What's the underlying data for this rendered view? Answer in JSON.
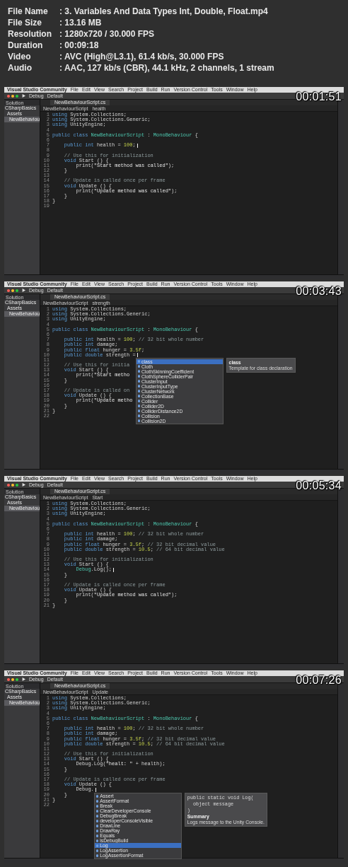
{
  "info": [
    {
      "label": "File Name",
      "value": ": 3. Variables And Data Types Int, Double, Float.mp4"
    },
    {
      "label": "File Size",
      "value": ": 13.16 MB"
    },
    {
      "label": "Resolution",
      "value": ": 1280x720 / 30.000 FPS"
    },
    {
      "label": "Duration",
      "value": ": 00:09:18"
    },
    {
      "label": "Video",
      "value": ": AVC (High@L3.1), 61.4 kb/s, 30.000 FPS"
    },
    {
      "label": "Audio",
      "value": ": AAC, 127 kb/s (CBR), 44.1 kHz, 2 channels, 1 stream"
    }
  ],
  "frames": [
    {
      "timestamp": "00:01:51",
      "app": "Visual Studio Community",
      "menu": [
        "File",
        "Edit",
        "View",
        "Search",
        "Project",
        "Build",
        "Run",
        "Version Control",
        "Tools",
        "Window",
        "Help"
      ],
      "config": [
        "Debug",
        "Default"
      ],
      "solution_label": "Solution",
      "tree": [
        {
          "label": "CSharpBasics",
          "selected": false,
          "children": [
            {
              "label": "Assets",
              "selected": false,
              "children": [
                {
                  "label": "NewBehaviou",
                  "selected": true
                }
              ]
            }
          ]
        }
      ],
      "tab": "NewBehaviourScript.cs",
      "breadcrumb": [
        "NewBehaviourScript",
        "health"
      ],
      "code": [
        {
          "n": "1",
          "parts": [
            {
              "kind": "keyword",
              "text": "using "
            },
            {
              "kind": "plain",
              "text": "System.Collections;"
            }
          ]
        },
        {
          "n": "2",
          "parts": [
            {
              "kind": "keyword",
              "text": "using "
            },
            {
              "kind": "plain",
              "text": "System.Collections.Generic;"
            }
          ]
        },
        {
          "n": "3",
          "parts": [
            {
              "kind": "keyword",
              "text": "using "
            },
            {
              "kind": "plain",
              "text": "UnityEngine;"
            }
          ]
        },
        {
          "n": "4"
        },
        {
          "n": "5",
          "parts": [
            {
              "kind": "keyword",
              "text": "public class "
            },
            {
              "kind": "type",
              "text": "NewBehaviourScript"
            },
            {
              "kind": "plain",
              "text": " : "
            },
            {
              "kind": "type",
              "text": "MonoBehaviour"
            },
            {
              "kind": "plain",
              "text": " {"
            }
          ]
        },
        {
          "n": "6"
        },
        {
          "n": "7",
          "parts": [
            {
              "kind": "keyword",
              "text": "    public int "
            },
            {
              "kind": "plain",
              "text": "health = "
            },
            {
              "kind": "number",
              "text": "100"
            },
            {
              "kind": "plain",
              "text": ";"
            },
            {
              "kind": "caret"
            }
          ]
        },
        {
          "n": "8"
        },
        {
          "n": "9",
          "parts": [
            {
              "kind": "comment",
              "text": "    // Use this for initialization"
            }
          ]
        },
        {
          "n": "10",
          "parts": [
            {
              "kind": "keyword",
              "text": "    void "
            },
            {
              "kind": "plain",
              "text": "Start () {"
            }
          ]
        },
        {
          "n": "11",
          "parts": [
            {
              "kind": "plain",
              "text": "        print("
            },
            {
              "kind": "string",
              "text": "\"Start method was called\""
            },
            {
              "kind": "plain",
              "text": ");"
            }
          ]
        },
        {
          "n": "12",
          "parts": [
            {
              "kind": "plain",
              "text": "    }"
            }
          ]
        },
        {
          "n": "13"
        },
        {
          "n": "14",
          "parts": [
            {
              "kind": "comment",
              "text": "    // Update is called once per frame"
            }
          ]
        },
        {
          "n": "15",
          "parts": [
            {
              "kind": "keyword",
              "text": "    void "
            },
            {
              "kind": "plain",
              "text": "Update () {"
            }
          ]
        },
        {
          "n": "16",
          "parts": [
            {
              "kind": "plain",
              "text": "        print("
            },
            {
              "kind": "string",
              "text": "\"Update method was called\""
            },
            {
              "kind": "plain",
              "text": ");"
            }
          ]
        },
        {
          "n": "17",
          "parts": [
            {
              "kind": "plain",
              "text": "    }"
            }
          ]
        },
        {
          "n": "18",
          "parts": [
            {
              "kind": "plain",
              "text": "}"
            }
          ]
        },
        {
          "n": "19"
        }
      ]
    },
    {
      "timestamp": "00:03:43",
      "app": "Visual Studio Community",
      "menu": [
        "File",
        "Edit",
        "View",
        "Search",
        "Project",
        "Build",
        "Run",
        "Version Control",
        "Tools",
        "Window",
        "Help"
      ],
      "config": [
        "Debug",
        "Default"
      ],
      "solution_label": "Solution",
      "tree": [
        {
          "label": "CSharpBasics",
          "selected": false,
          "children": [
            {
              "label": "Assets",
              "selected": false,
              "children": [
                {
                  "label": "NewBehaviou",
                  "selected": true
                }
              ]
            }
          ]
        }
      ],
      "tab": "NewBehaviourScript.cs",
      "breadcrumb": [
        "NewBehaviourScript",
        "strength"
      ],
      "code": [
        {
          "n": "1",
          "parts": [
            {
              "kind": "keyword",
              "text": "using "
            },
            {
              "kind": "plain",
              "text": "System.Collections;"
            }
          ]
        },
        {
          "n": "2",
          "parts": [
            {
              "kind": "keyword",
              "text": "using "
            },
            {
              "kind": "plain",
              "text": "System.Collections.Generic;"
            }
          ]
        },
        {
          "n": "3",
          "parts": [
            {
              "kind": "keyword",
              "text": "using "
            },
            {
              "kind": "plain",
              "text": "UnityEngine;"
            }
          ]
        },
        {
          "n": "4"
        },
        {
          "n": "5",
          "parts": [
            {
              "kind": "keyword",
              "text": "public class "
            },
            {
              "kind": "type",
              "text": "NewBehaviourScript"
            },
            {
              "kind": "plain",
              "text": " : "
            },
            {
              "kind": "type",
              "text": "MonoBehaviour"
            },
            {
              "kind": "plain",
              "text": " {"
            }
          ]
        },
        {
          "n": "6"
        },
        {
          "n": "7",
          "parts": [
            {
              "kind": "keyword",
              "text": "    public int "
            },
            {
              "kind": "plain",
              "text": "health = "
            },
            {
              "kind": "number",
              "text": "100"
            },
            {
              "kind": "plain",
              "text": "; "
            },
            {
              "kind": "comment",
              "text": "// 32 bit whole number"
            }
          ]
        },
        {
          "n": "8",
          "parts": [
            {
              "kind": "keyword",
              "text": "    public int "
            },
            {
              "kind": "plain",
              "text": "damage;"
            }
          ]
        },
        {
          "n": "9",
          "parts": [
            {
              "kind": "keyword",
              "text": "    public float "
            },
            {
              "kind": "plain",
              "text": "hunger = "
            },
            {
              "kind": "number",
              "text": "3.5f"
            },
            {
              "kind": "plain",
              "text": ";"
            }
          ]
        },
        {
          "n": "10",
          "parts": [
            {
              "kind": "keyword",
              "text": "    public double "
            },
            {
              "kind": "plain",
              "text": "strength ="
            },
            {
              "kind": "caret"
            }
          ]
        },
        {
          "n": "11"
        },
        {
          "n": "12",
          "parts": [
            {
              "kind": "comment",
              "text": "    // Use this for initia"
            }
          ]
        },
        {
          "n": "13",
          "parts": [
            {
              "kind": "keyword",
              "text": "    void "
            },
            {
              "kind": "plain",
              "text": "Start () {"
            }
          ]
        },
        {
          "n": "14",
          "parts": [
            {
              "kind": "plain",
              "text": "        print("
            },
            {
              "kind": "string",
              "text": "\"Start metho"
            }
          ]
        },
        {
          "n": "15",
          "parts": [
            {
              "kind": "plain",
              "text": "    }"
            }
          ]
        },
        {
          "n": "16"
        },
        {
          "n": "17",
          "parts": [
            {
              "kind": "comment",
              "text": "    // Update is called on"
            }
          ]
        },
        {
          "n": "18",
          "parts": [
            {
              "kind": "keyword",
              "text": "    void "
            },
            {
              "kind": "plain",
              "text": "Update () {"
            }
          ]
        },
        {
          "n": "19",
          "parts": [
            {
              "kind": "plain",
              "text": "        print("
            },
            {
              "kind": "string",
              "text": "\"Update metho"
            }
          ]
        },
        {
          "n": "20",
          "parts": [
            {
              "kind": "plain",
              "text": "    }"
            }
          ]
        },
        {
          "n": "21",
          "parts": [
            {
              "kind": "plain",
              "text": "}"
            }
          ]
        },
        {
          "n": "22"
        }
      ],
      "completion": {
        "items": [
          {
            "label": "class",
            "selected": true
          },
          {
            "label": "Cloth",
            "selected": false
          },
          {
            "label": "ClothSkinningCoefficient",
            "selected": false
          },
          {
            "label": "ClothSphereColliderPair",
            "selected": false
          },
          {
            "label": "ClusterInput",
            "selected": false
          },
          {
            "label": "ClusterInputType",
            "selected": false
          },
          {
            "label": "ClusterNetwork",
            "selected": false
          },
          {
            "label": "CollectionBase",
            "selected": false
          },
          {
            "label": "Collider",
            "selected": false
          },
          {
            "label": "Collider2D",
            "selected": false
          },
          {
            "label": "ColliderDistance2D",
            "selected": false
          },
          {
            "label": "Collision",
            "selected": false
          },
          {
            "label": "Collision2D",
            "selected": false
          }
        ],
        "tooltip": {
          "title": "class",
          "text": "Template for class declaration"
        }
      }
    },
    {
      "timestamp": "00:05:34",
      "app": "Visual Studio Community",
      "menu": [
        "File",
        "Edit",
        "View",
        "Search",
        "Project",
        "Build",
        "Run",
        "Version Control",
        "Tools",
        "Window",
        "Help"
      ],
      "config": [
        "Debug",
        "Default"
      ],
      "solution_label": "Solution",
      "tree": [
        {
          "label": "CSharpBasics",
          "selected": false,
          "children": [
            {
              "label": "Assets",
              "selected": false,
              "children": [
                {
                  "label": "NewBehaviou",
                  "selected": true
                }
              ]
            }
          ]
        }
      ],
      "tab": "NewBehaviourScript.cs",
      "breadcrumb": [
        "NewBehaviourScript",
        "Start"
      ],
      "code": [
        {
          "n": "1",
          "parts": [
            {
              "kind": "keyword",
              "text": "using "
            },
            {
              "kind": "plain",
              "text": "System.Collections;"
            }
          ]
        },
        {
          "n": "2",
          "parts": [
            {
              "kind": "keyword",
              "text": "using "
            },
            {
              "kind": "plain",
              "text": "System.Collections.Generic;"
            }
          ]
        },
        {
          "n": "3",
          "parts": [
            {
              "kind": "keyword",
              "text": "using "
            },
            {
              "kind": "plain",
              "text": "UnityEngine;"
            }
          ]
        },
        {
          "n": "4"
        },
        {
          "n": "5",
          "parts": [
            {
              "kind": "keyword",
              "text": "public class "
            },
            {
              "kind": "type",
              "text": "NewBehaviourScript"
            },
            {
              "kind": "plain",
              "text": " : "
            },
            {
              "kind": "type",
              "text": "MonoBehaviour"
            },
            {
              "kind": "plain",
              "text": " {"
            }
          ]
        },
        {
          "n": "6"
        },
        {
          "n": "7",
          "parts": [
            {
              "kind": "keyword",
              "text": "    public int "
            },
            {
              "kind": "plain",
              "text": "health = "
            },
            {
              "kind": "number",
              "text": "100"
            },
            {
              "kind": "plain",
              "text": "; "
            },
            {
              "kind": "comment",
              "text": "// 32 bit whole number"
            }
          ]
        },
        {
          "n": "8",
          "parts": [
            {
              "kind": "keyword",
              "text": "    public int "
            },
            {
              "kind": "plain",
              "text": "damage;"
            }
          ]
        },
        {
          "n": "9",
          "parts": [
            {
              "kind": "keyword",
              "text": "    public float "
            },
            {
              "kind": "plain",
              "text": "hunger = "
            },
            {
              "kind": "number",
              "text": "3.5f"
            },
            {
              "kind": "plain",
              "text": "; "
            },
            {
              "kind": "comment",
              "text": "// 32 bit decimal value"
            }
          ]
        },
        {
          "n": "10",
          "parts": [
            {
              "kind": "keyword",
              "text": "    public double "
            },
            {
              "kind": "plain",
              "text": "strength = "
            },
            {
              "kind": "number",
              "text": "10.5"
            },
            {
              "kind": "plain",
              "text": "; "
            },
            {
              "kind": "comment",
              "text": "// 64 bit decimal value"
            }
          ]
        },
        {
          "n": "11"
        },
        {
          "n": "12",
          "parts": [
            {
              "kind": "comment",
              "text": "    // Use this for initialization"
            }
          ]
        },
        {
          "n": "13",
          "parts": [
            {
              "kind": "keyword",
              "text": "    void "
            },
            {
              "kind": "plain",
              "text": "Start () {"
            }
          ]
        },
        {
          "n": "14",
          "parts": [
            {
              "kind": "type",
              "text": "        Debug"
            },
            {
              "kind": "plain",
              "text": ".Log();"
            },
            {
              "kind": "caret"
            }
          ]
        },
        {
          "n": "15",
          "parts": [
            {
              "kind": "plain",
              "text": "    }"
            }
          ]
        },
        {
          "n": "16"
        },
        {
          "n": "17",
          "parts": [
            {
              "kind": "comment",
              "text": "    // Update is called once per frame"
            }
          ]
        },
        {
          "n": "18",
          "parts": [
            {
              "kind": "keyword",
              "text": "    void "
            },
            {
              "kind": "plain",
              "text": "Update () {"
            }
          ]
        },
        {
          "n": "19",
          "parts": [
            {
              "kind": "plain",
              "text": "        print("
            },
            {
              "kind": "string",
              "text": "\"Update method was called\""
            },
            {
              "kind": "plain",
              "text": ");"
            }
          ]
        },
        {
          "n": "20",
          "parts": [
            {
              "kind": "plain",
              "text": "    }"
            }
          ]
        },
        {
          "n": "21",
          "parts": [
            {
              "kind": "plain",
              "text": "}"
            }
          ]
        }
      ]
    },
    {
      "timestamp": "00:07:26",
      "app": "Visual Studio Community",
      "menu": [
        "File",
        "Edit",
        "View",
        "Search",
        "Project",
        "Build",
        "Run",
        "Version Control",
        "Tools",
        "Window",
        "Help"
      ],
      "config": [
        "Debug",
        "Default"
      ],
      "solution_label": "Solution",
      "tree": [
        {
          "label": "CSharpBasics",
          "selected": false,
          "children": [
            {
              "label": "Assets",
              "selected": false,
              "children": [
                {
                  "label": "NewBehaviou",
                  "selected": true
                }
              ]
            }
          ]
        }
      ],
      "tab": "NewBehaviourScript.cs",
      "breadcrumb": [
        "NewBehaviourScript",
        "Update"
      ],
      "code": [
        {
          "n": "1",
          "parts": [
            {
              "kind": "keyword",
              "text": "using "
            },
            {
              "kind": "plain",
              "text": "System.Collections;"
            }
          ]
        },
        {
          "n": "2",
          "parts": [
            {
              "kind": "keyword",
              "text": "using "
            },
            {
              "kind": "plain",
              "text": "System.Collections.Generic;"
            }
          ]
        },
        {
          "n": "3",
          "parts": [
            {
              "kind": "keyword",
              "text": "using "
            },
            {
              "kind": "plain",
              "text": "UnityEngine;"
            }
          ]
        },
        {
          "n": "4"
        },
        {
          "n": "5",
          "parts": [
            {
              "kind": "keyword",
              "text": "public class "
            },
            {
              "kind": "type",
              "text": "NewBehaviourScript"
            },
            {
              "kind": "plain",
              "text": " : "
            },
            {
              "kind": "type",
              "text": "MonoBehaviour"
            },
            {
              "kind": "plain",
              "text": " {"
            }
          ]
        },
        {
          "n": "6"
        },
        {
          "n": "7",
          "parts": [
            {
              "kind": "keyword",
              "text": "    public int "
            },
            {
              "kind": "plain",
              "text": "health = "
            },
            {
              "kind": "number",
              "text": "100"
            },
            {
              "kind": "plain",
              "text": "; "
            },
            {
              "kind": "comment",
              "text": "// 32 bit whole number"
            }
          ]
        },
        {
          "n": "8",
          "parts": [
            {
              "kind": "keyword",
              "text": "    public int "
            },
            {
              "kind": "plain",
              "text": "damage;"
            }
          ]
        },
        {
          "n": "9",
          "parts": [
            {
              "kind": "keyword",
              "text": "    public float "
            },
            {
              "kind": "plain",
              "text": "hunger = "
            },
            {
              "kind": "number",
              "text": "3.5f"
            },
            {
              "kind": "plain",
              "text": "; "
            },
            {
              "kind": "comment",
              "text": "// 32 bit decimal value"
            }
          ]
        },
        {
          "n": "10",
          "parts": [
            {
              "kind": "keyword",
              "text": "    public double "
            },
            {
              "kind": "plain",
              "text": "strength = "
            },
            {
              "kind": "number",
              "text": "10.5"
            },
            {
              "kind": "plain",
              "text": "; "
            },
            {
              "kind": "comment",
              "text": "// 64 bit decimal value"
            }
          ]
        },
        {
          "n": "11"
        },
        {
          "n": "12",
          "parts": [
            {
              "kind": "comment",
              "text": "    // Use this for initialization"
            }
          ]
        },
        {
          "n": "13",
          "parts": [
            {
              "kind": "keyword",
              "text": "    void "
            },
            {
              "kind": "plain",
              "text": "Start () {"
            }
          ]
        },
        {
          "n": "14",
          "parts": [
            {
              "kind": "plain",
              "text": "        Debug.Log("
            },
            {
              "kind": "string",
              "text": "\"healt: \""
            },
            {
              "kind": "plain",
              "text": " + health);"
            }
          ]
        },
        {
          "n": "15",
          "parts": [
            {
              "kind": "plain",
              "text": "    }"
            }
          ]
        },
        {
          "n": "16"
        },
        {
          "n": "17",
          "parts": [
            {
              "kind": "comment",
              "text": "    // Update is called once per frame"
            }
          ]
        },
        {
          "n": "18",
          "parts": [
            {
              "kind": "keyword",
              "text": "    void "
            },
            {
              "kind": "plain",
              "text": "Update () {"
            }
          ]
        },
        {
          "n": "19",
          "parts": [
            {
              "kind": "plain",
              "text": "        Debug."
            },
            {
              "kind": "caret"
            }
          ]
        },
        {
          "n": "20",
          "parts": [
            {
              "kind": "plain",
              "text": "    }"
            }
          ]
        },
        {
          "n": "21",
          "parts": [
            {
              "kind": "plain",
              "text": "}"
            }
          ]
        },
        {
          "n": "22"
        }
      ],
      "completion": {
        "items": [
          {
            "label": "Assert",
            "selected": false
          },
          {
            "label": "AssertFormat",
            "selected": false
          },
          {
            "label": "Break",
            "selected": false
          },
          {
            "label": "ClearDeveloperConsole",
            "selected": false
          },
          {
            "label": "DebugBreak",
            "selected": false
          },
          {
            "label": "developerConsoleVisible",
            "selected": false
          },
          {
            "label": "DrawLine",
            "selected": false
          },
          {
            "label": "DrawRay",
            "selected": false
          },
          {
            "label": "Equals",
            "selected": false
          },
          {
            "label": "isDebugBuild",
            "selected": false
          },
          {
            "label": "Log",
            "selected": true
          },
          {
            "label": "LogAssertion",
            "selected": false
          },
          {
            "label": "LogAssertionFormat",
            "selected": false
          }
        ],
        "tooltip": {
          "code": [
            "public static void Log(",
            "  object message",
            ")"
          ],
          "title": "Summary",
          "text": "Logs message to the Unity Console."
        }
      }
    }
  ]
}
